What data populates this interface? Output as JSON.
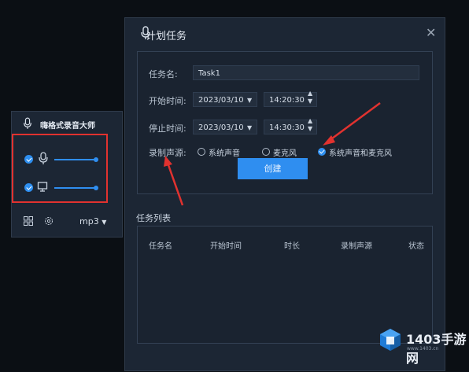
{
  "dialog": {
    "title": "计划任务",
    "close_glyph": "✕",
    "task_name_label": "任务名:",
    "task_name_value": "Task1",
    "start_label": "开始时间:",
    "start_date": "2023/03/10",
    "start_time": "14:20:30",
    "stop_label": "停止时间:",
    "stop_date": "2023/03/10",
    "stop_time": "14:30:30",
    "source_label": "录制声源:",
    "source_options": [
      "系统声音",
      "麦克风",
      "系统声音和麦克风"
    ],
    "source_selected": "系统声音和麦克风",
    "create_button": "创建",
    "list_title": "任务列表",
    "list_headers": [
      "任务名",
      "开始时间",
      "时长",
      "录制声源",
      "状态"
    ]
  },
  "widget": {
    "title": "嗨格式录音大师",
    "mic_checked": true,
    "system_checked": true,
    "format": "mp3"
  },
  "watermark": {
    "brand": "1403手游网",
    "sub": "www.1403.cn"
  },
  "colors": {
    "accent": "#2f8ef0",
    "highlight_red": "#e1322f",
    "panel": "#1c2634",
    "background": "#0b0f14"
  }
}
